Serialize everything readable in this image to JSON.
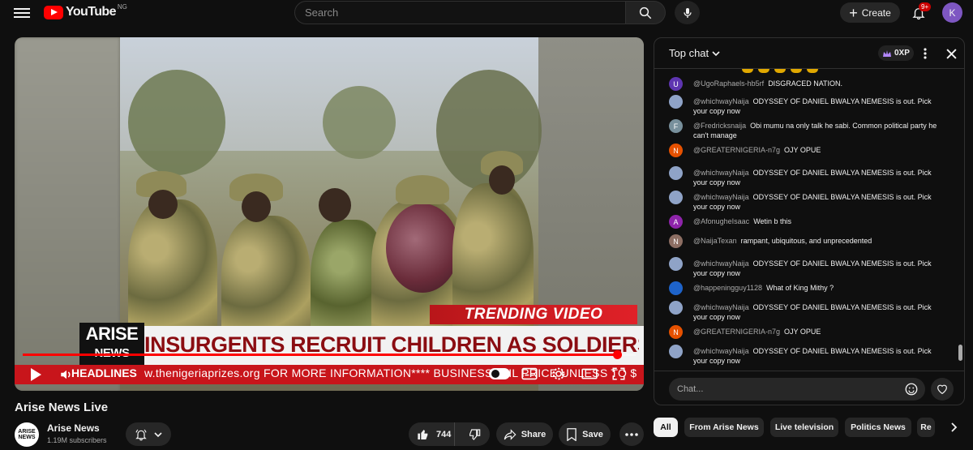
{
  "header": {
    "logo_text": "YouTube",
    "country_code": "NG",
    "search_placeholder": "Search",
    "create_label": "Create",
    "notification_count": "9+",
    "avatar_initial": "K"
  },
  "video": {
    "overlay_trending": "TRENDING VIDEO",
    "overlay_logo_top": "ARISE",
    "overlay_logo_bottom": "NEWS",
    "overlay_headline": "INSURGENTS RECRUIT CHILDREN AS SOLDIERS",
    "overlay_ticker_label": "HEADLINES",
    "overlay_ticker_text": "w.thenigeriaprizes.org FOR MORE INFORMATION**** BUSINESS: OIL PRICE UNLESS TO $",
    "progress_fraction": 0.97,
    "title": "Arise News Live"
  },
  "channel": {
    "logo_text_top": "ARISE",
    "logo_text_bottom": "NEWS",
    "name": "Arise News",
    "subscribers": "1.19M subscribers"
  },
  "actions": {
    "like_count": "744",
    "share_label": "Share",
    "save_label": "Save"
  },
  "chat": {
    "mode_label": "Top chat",
    "xp_label": "0XP",
    "input_placeholder": "Chat...",
    "messages": [
      {
        "initial": "U",
        "color": "#5e35b1",
        "author": "@UgoRaphaels-hb5rf",
        "text": "DISGRACED NATION."
      },
      {
        "initial": "",
        "color": "#8fa3c7",
        "author": "@whichwayNaija",
        "text": "ODYSSEY OF DANIEL BWALYA NEMESIS is out. Pick your copy now"
      },
      {
        "initial": "F",
        "color": "#78909c",
        "author": "@Fredricksnaija",
        "text": "Obi mumu na only talk he sabi. Common political party he can't manage"
      },
      {
        "initial": "N",
        "color": "#e65100",
        "author": "@GREATERNIGERIA-n7g",
        "text": "OJY OPUE"
      },
      {
        "initial": "",
        "color": "#8fa3c7",
        "author": "@whichwayNaija",
        "text": "ODYSSEY OF DANIEL BWALYA NEMESIS is out. Pick your copy now"
      },
      {
        "initial": "",
        "color": "#8fa3c7",
        "author": "@whichwayNaija",
        "text": "ODYSSEY OF DANIEL BWALYA NEMESIS is out. Pick your copy now"
      },
      {
        "initial": "A",
        "color": "#8e24aa",
        "author": "@AfonugheIsaac",
        "text": "Wetin b this"
      },
      {
        "initial": "N",
        "color": "#8d6e63",
        "author": "@NaijaTexan",
        "text": "rampant, ubiquitous, and unprecedented"
      },
      {
        "initial": "",
        "color": "#8fa3c7",
        "author": "@whichwayNaija",
        "text": "ODYSSEY OF DANIEL BWALYA NEMESIS is out. Pick your copy now"
      },
      {
        "initial": "",
        "color": "#1e63c9",
        "author": "@happeningguy1128",
        "text": "What of King Mithy ?"
      },
      {
        "initial": "",
        "color": "#8fa3c7",
        "author": "@whichwayNaija",
        "text": "ODYSSEY OF DANIEL BWALYA NEMESIS is out. Pick your copy now"
      },
      {
        "initial": "N",
        "color": "#e65100",
        "author": "@GREATERNIGERIA-n7g",
        "text": "OJY OPUE"
      },
      {
        "initial": "",
        "color": "#8fa3c7",
        "author": "@whichwayNaija",
        "text": "ODYSSEY OF DANIEL BWALYA NEMESIS is out. Pick your copy now"
      }
    ]
  },
  "chips": [
    "All",
    "From Arise News",
    "Live television",
    "Politics News",
    "Re"
  ]
}
